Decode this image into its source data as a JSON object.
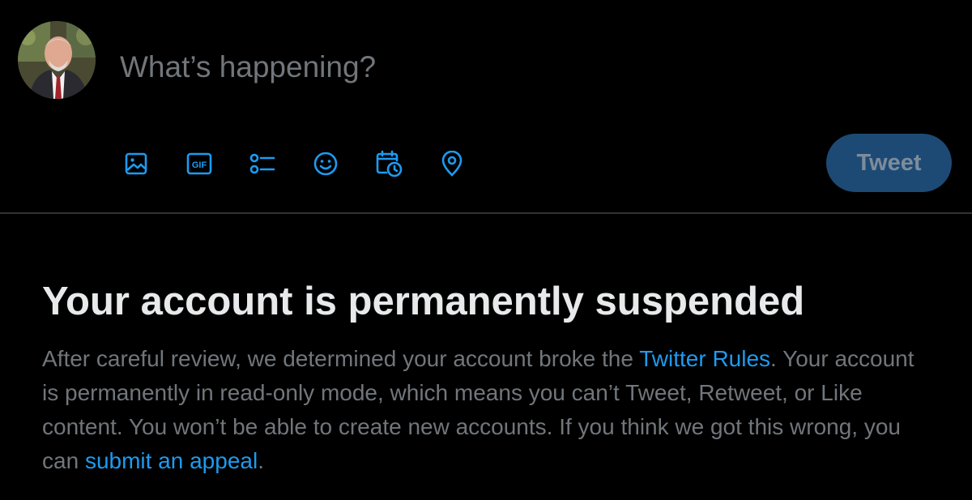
{
  "composer": {
    "placeholder": "What’s happening?",
    "tweet_label": "Tweet",
    "toolbar_icons": [
      "media-icon",
      "gif-icon",
      "poll-icon",
      "emoji-icon",
      "schedule-icon",
      "location-icon"
    ],
    "icon_color": "#1d9bf0",
    "gif_text": "GIF"
  },
  "notice": {
    "title": "Your account is permanently suspended",
    "body_part1": "After careful review, we determined your account broke the ",
    "rules_link": "Twitter Rules",
    "body_part2": ". Your account is permanently in read-only mode, which means you can’t Tweet, Retweet, or Like content. You won’t be able to create new accounts. If you think we got this wrong, you can ",
    "appeal_link": "submit an appeal",
    "body_part3": "."
  },
  "colors": {
    "background": "#000000",
    "accent": "#1d9bf0",
    "tweet_button_bg": "#1d4a74",
    "muted_text": "#71767b",
    "divider": "#2f3336"
  }
}
